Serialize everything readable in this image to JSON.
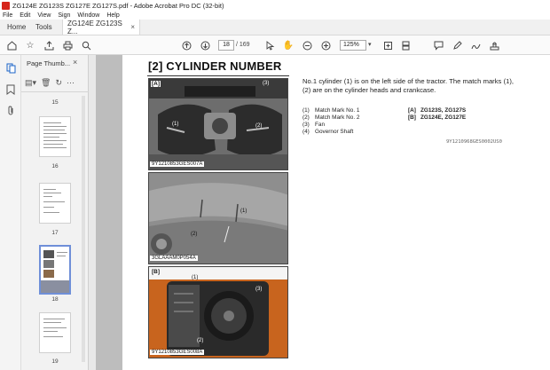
{
  "window": {
    "title": "ZG124E ZG123S ZG127E ZG127S.pdf - Adobe Acrobat Pro DC (32-bit)"
  },
  "menu": [
    "File",
    "Edit",
    "View",
    "Sign",
    "Window",
    "Help"
  ],
  "tabs": {
    "home": "Home",
    "tools": "Tools",
    "document": "ZG124E ZG123S Z...",
    "close": "×"
  },
  "toolbar": {
    "current_page": "18",
    "total_pages": "/ 169",
    "zoom": "125%"
  },
  "thumbnail_panel": {
    "title": "Page Thumb...",
    "close": "×",
    "thumbnails": [
      {
        "label": "15"
      },
      {
        "label": "16"
      },
      {
        "label": "17"
      },
      {
        "label": "18",
        "selected": true
      },
      {
        "label": "19"
      }
    ]
  },
  "document": {
    "heading": "[2]  CYLINDER NUMBER",
    "description": "No.1 cylinder (1) is on the left side of the tractor. The match marks (1), (2) are on the cylinder heads and crankcase.",
    "legend": [
      {
        "num": "(1)",
        "text": "Match Mark No. 1",
        "key": "[A]",
        "models": "ZG123S, ZG127S"
      },
      {
        "num": "(2)",
        "text": "Match Mark No. 2",
        "key": "[B]",
        "models": "ZG124E, ZG127E"
      },
      {
        "num": "(3)",
        "text": "Fan",
        "key": "",
        "models": ""
      },
      {
        "num": "(4)",
        "text": "Governor Shaft",
        "key": "",
        "models": ""
      }
    ],
    "ref_code": "9Y1210968GES0002US0",
    "photos": [
      {
        "label": "[A]",
        "code": "9Y1210853GES007A",
        "callouts": [
          "(3)",
          "(1)",
          "(2)"
        ]
      },
      {
        "label": "",
        "code": "3GLAAAM0P054A",
        "callouts": [
          "(1)",
          "(2)"
        ]
      },
      {
        "label": "[B]",
        "code": "9Y1210853GES008A",
        "callouts": [
          "(1)",
          "(3)",
          "(2)"
        ]
      }
    ]
  }
}
